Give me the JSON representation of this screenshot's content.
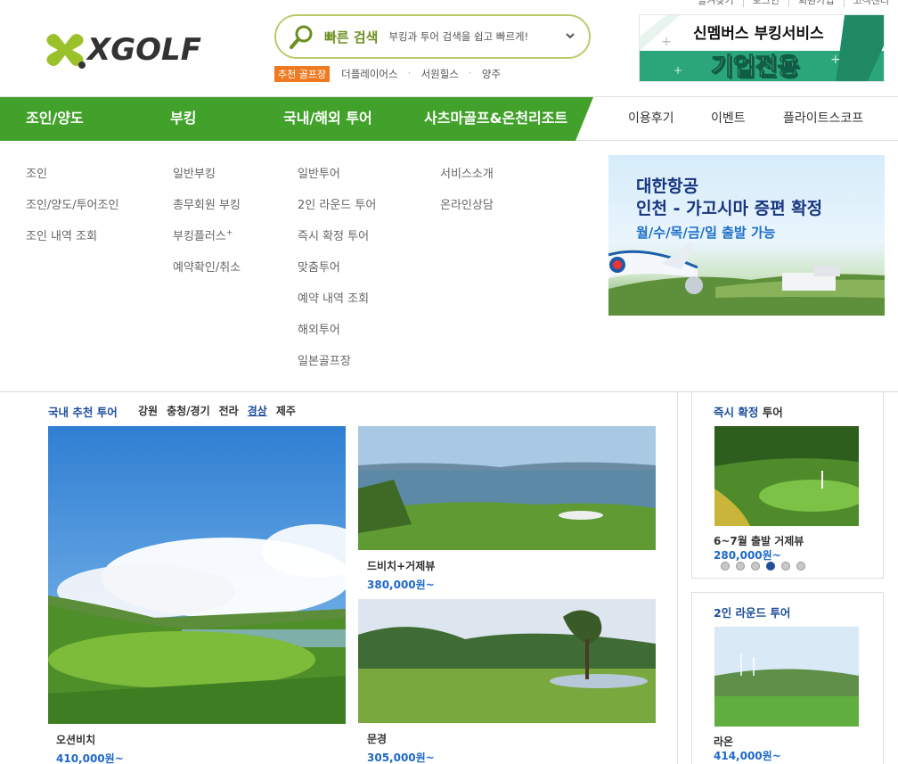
{
  "util_links": [
    "즐겨찾기",
    "로그인",
    "회원가입",
    "고객센터"
  ],
  "logo": {
    "text": "XGOLF",
    "colors": {
      "mark": "#9ac12a",
      "dot": "#f07a21"
    }
  },
  "search": {
    "label": "빠른 검색",
    "placeholder": "부킹과 투어 검색을 쉽고 빠르게!",
    "icon": "search-icon"
  },
  "keywords": {
    "badge": "추천 골프장",
    "items": [
      "더플레이어스",
      "서원힐스",
      "양주"
    ]
  },
  "corp_banner": {
    "title": "신멤버스 부킹서비스",
    "subtitle": "기업전용"
  },
  "nav": {
    "main": [
      "조인/양도",
      "부킹",
      "국내/해외 투어",
      "사츠마골프&온천리조트"
    ],
    "sub": [
      "이용후기",
      "이벤트",
      "플라이트스코프"
    ],
    "colors": {
      "active": "#42a12a"
    }
  },
  "menu": {
    "col1": [
      "조인",
      "조인/양도/투어조인",
      "조인 내역 조회"
    ],
    "col2": [
      "일반부킹",
      "총무회원 부킹",
      "부킹플러스",
      "예약확인/취소"
    ],
    "col2_sup": "+",
    "col3": [
      "일반투어",
      "2인 라운드 투어",
      "즉시 확정 투어",
      "맞춤투어",
      "예약 내역 조회",
      "해외투어",
      "일본골프장"
    ],
    "col4": [
      "서비스소개",
      "온라인상담"
    ]
  },
  "kal_banner": {
    "line1": "대한항공",
    "line2": "인천 - 가고시마 증편 확정",
    "line3": "월/수/목/금/일 출발 가능"
  },
  "domestic": {
    "title": "국내 추천 투어",
    "regions": [
      "강원",
      "충청/경기",
      "전라",
      "경상",
      "제주"
    ],
    "active_region": "경상",
    "cards": [
      {
        "name": "오션비치",
        "price": "410,000원~"
      },
      {
        "name": "드비치+거제뷰",
        "price": "380,000원~"
      },
      {
        "name": "문경",
        "price": "305,000원~"
      }
    ]
  },
  "instant": {
    "title_highlight": "즉시 확정",
    "title_rest": " 투어",
    "name": "6~7월 출발 거제뷰",
    "price": "280,000원~",
    "dots": 6,
    "active_dot": 3
  },
  "tworound": {
    "title": "2인 라운드 투어",
    "name": "라온",
    "price": "414,000원~"
  }
}
